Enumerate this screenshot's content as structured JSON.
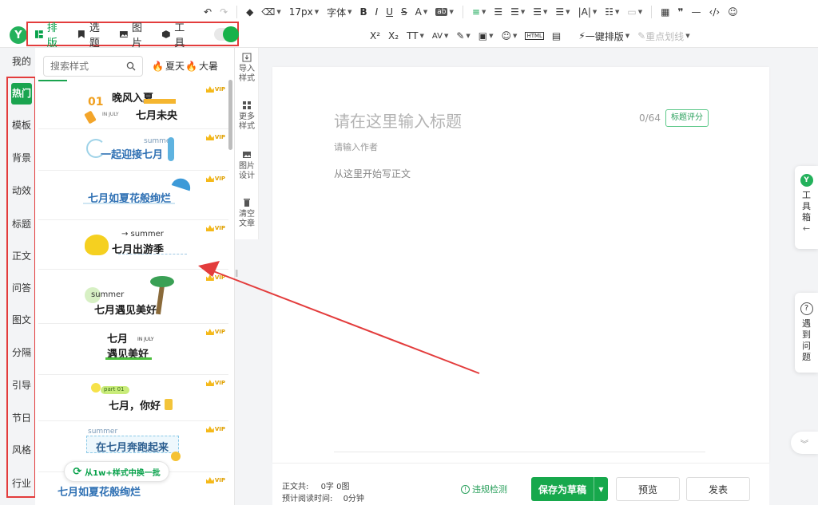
{
  "toolbar": {
    "row1": [
      {
        "name": "undo-icon",
        "glyph": "↶"
      },
      {
        "name": "redo-icon",
        "glyph": "↷"
      },
      {
        "name": "format-brush-icon",
        "glyph": "◆"
      },
      {
        "name": "clear-format-icon",
        "glyph": "⌫"
      },
      {
        "name": "font-size-select",
        "label": "17px"
      },
      {
        "name": "font-family-select",
        "label": "字体"
      },
      {
        "name": "bold-icon",
        "glyph": "B"
      },
      {
        "name": "italic-icon",
        "glyph": "I"
      },
      {
        "name": "underline-icon",
        "glyph": "U"
      },
      {
        "name": "strikethrough-icon",
        "glyph": "S"
      },
      {
        "name": "font-color-icon",
        "glyph": "A"
      },
      {
        "name": "background-color-icon",
        "glyph": "ab"
      },
      {
        "name": "align-icon",
        "glyph": "≡"
      },
      {
        "name": "indent-icon",
        "glyph": "☰"
      },
      {
        "name": "line-height-icon",
        "glyph": "☰"
      },
      {
        "name": "paragraph-spacing-icon",
        "glyph": "☰"
      },
      {
        "name": "letter-spacing-icon",
        "glyph": "☰"
      },
      {
        "name": "text-direction-icon",
        "glyph": "|A|"
      },
      {
        "name": "list-icon",
        "glyph": "☷"
      },
      {
        "name": "heading-icon",
        "glyph": "▭"
      },
      {
        "name": "table-icon",
        "glyph": "▦"
      },
      {
        "name": "quote-icon",
        "glyph": "❞"
      },
      {
        "name": "divider-icon",
        "glyph": "—"
      },
      {
        "name": "code-icon",
        "glyph": "‹/›"
      },
      {
        "name": "emoji-icon",
        "glyph": "☺"
      }
    ],
    "row2": [
      {
        "name": "superscript-icon",
        "glyph": "X²"
      },
      {
        "name": "subscript-icon",
        "glyph": "X₂"
      },
      {
        "name": "text-transform-icon",
        "glyph": "TT"
      },
      {
        "name": "av-icon",
        "glyph": "AV"
      },
      {
        "name": "magic-icon",
        "glyph": "✎"
      },
      {
        "name": "image-insert-icon",
        "glyph": "▣"
      },
      {
        "name": "sticker-icon",
        "glyph": "☺"
      },
      {
        "name": "html-icon",
        "glyph": "HTML"
      },
      {
        "name": "toolbox-icon",
        "glyph": "▤"
      }
    ],
    "one_click_layout": "一键排版",
    "highlight_lines": "重点划线"
  },
  "topnav": {
    "logo": "Y",
    "items": [
      {
        "label": "排版",
        "active": true
      },
      {
        "label": "选题",
        "active": false
      },
      {
        "label": "图片",
        "active": false
      },
      {
        "label": "工具",
        "active": false
      }
    ]
  },
  "vtabs": [
    "我的",
    "热门",
    "模板",
    "背景",
    "动效",
    "标题",
    "正文",
    "问答",
    "图文",
    "分隔",
    "引导",
    "节日",
    "风格",
    "行业"
  ],
  "active_tab": "热门",
  "panel": {
    "search_placeholder": "搜索样式",
    "hot_tags": [
      "夏天",
      "大暑"
    ],
    "vip": "VIP",
    "cards": [
      {
        "title": "晚风入夏",
        "title2": "七月未央",
        "num": "01",
        "sub": "IN JULY"
      },
      {
        "title": "一起迎接七月",
        "sub": "summer"
      },
      {
        "title": "七月如夏花般绚烂"
      },
      {
        "title": "七月出游季",
        "sub": "→ summer"
      },
      {
        "title": "七月遇见美好",
        "sub": "summer"
      },
      {
        "title": "七月",
        "title2": "遇见美好",
        "sub": "IN JULY"
      },
      {
        "title": "七月，你好",
        "sub": "part 01"
      },
      {
        "title": "在七月奔跑起来",
        "sub": "summer"
      },
      {
        "title": "七月如夏花般绚烂"
      }
    ],
    "swap_label": "从1w+样式中换一批"
  },
  "mini_toolbar": [
    {
      "label": "导入样式"
    },
    {
      "label": "更多样式"
    },
    {
      "label": "图片设计"
    },
    {
      "label": "清空文章"
    }
  ],
  "editor": {
    "title_placeholder": "请在这里输入标题",
    "counter": "0/64",
    "score_button": "标题评分",
    "author_placeholder": "请输入作者",
    "body_placeholder": "从这里开始写正文"
  },
  "footer": {
    "body_count_label": "正文共:",
    "body_count_value": "0字 0图",
    "read_time_label": "预计阅读时间:",
    "read_time_value": "0分钟",
    "violation_check": "违规检测",
    "save_draft": "保存为草稿",
    "preview": "预览",
    "publish": "发表"
  },
  "right": {
    "toolbox_label": "工具箱",
    "help_label": "遇到问题"
  },
  "colors": {
    "brand_green": "#1aa44f",
    "annotation_red": "#e33c3c"
  }
}
